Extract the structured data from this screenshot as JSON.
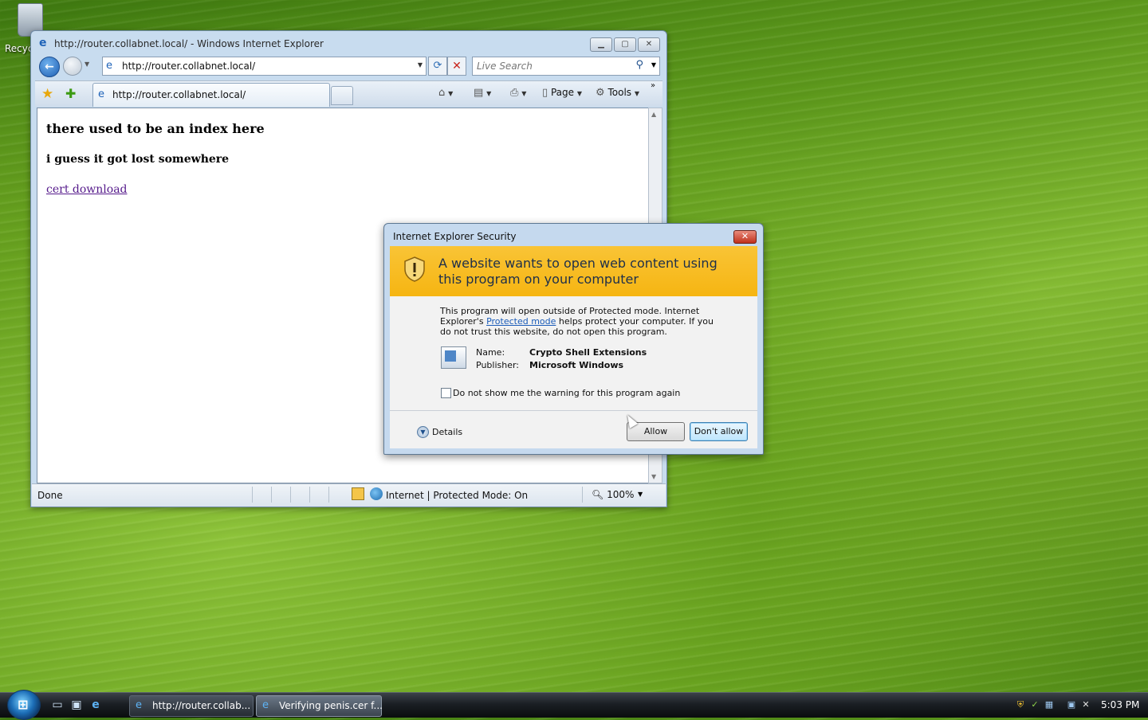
{
  "desktop": {
    "recycle_bin_label": "Recycle"
  },
  "ie": {
    "window_title": "http://router.collabnet.local/ - Windows Internet Explorer",
    "address": "http://router.collabnet.local/",
    "search_placeholder": "Live Search",
    "tab_label": "http://router.collabnet.local/",
    "commands": {
      "page": "Page",
      "tools": "Tools"
    },
    "content": {
      "heading": "there used to be an index here",
      "subheading": "i guess it got lost somewhere",
      "link": "cert download"
    },
    "status": {
      "text": "Done",
      "zone": "Internet | Protected Mode: On",
      "zoom": "100%"
    }
  },
  "dialog": {
    "title": "Internet Explorer Security",
    "banner": "A website wants to open web content using this program on your computer",
    "info_before": "This program will open outside of Protected mode. Internet Explorer's ",
    "info_link": "Protected mode",
    "info_after": " helps protect your computer. If you do not trust this website, do not open this program.",
    "name_label": "Name:",
    "name_value": "Crypto Shell Extensions",
    "publisher_label": "Publisher:",
    "publisher_value": "Microsoft Windows",
    "checkbox_label": "Do not show me the warning for this program again",
    "details": "Details",
    "allow": "Allow",
    "deny": "Don't allow"
  },
  "taskbar": {
    "tasks": [
      {
        "label": "http://router.collab..."
      },
      {
        "label": "Verifying penis.cer f..."
      }
    ],
    "clock": "5:03 PM"
  },
  "colors": {
    "banner": "#f6b512",
    "accent": "#1e63b8",
    "link_visited": "#551a8b"
  }
}
